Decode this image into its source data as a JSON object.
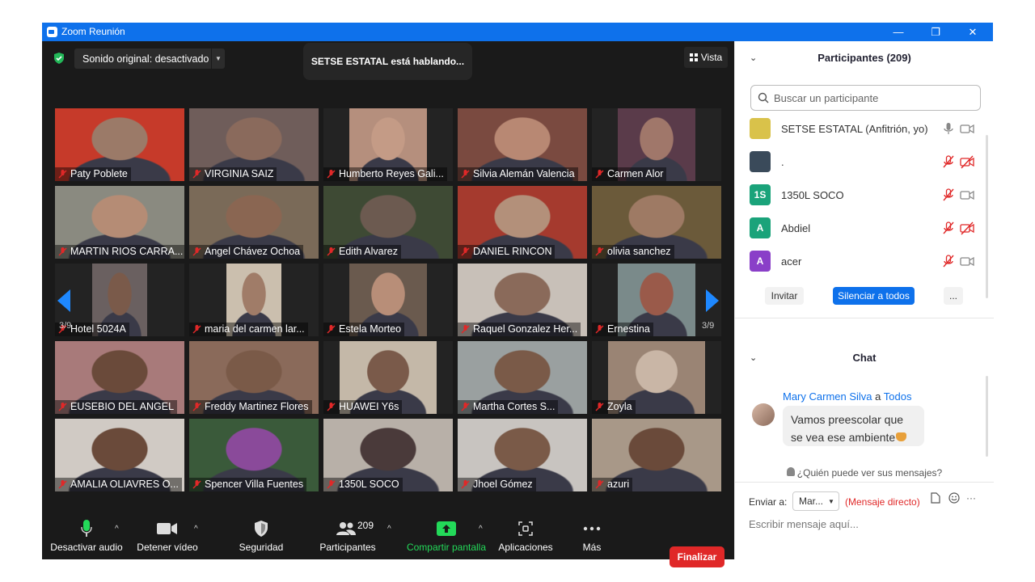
{
  "window": {
    "title": "Zoom Reunión",
    "minimize": "—",
    "restore": "❐",
    "close": "✕"
  },
  "top": {
    "sound_label": "Sonido original: desactivado",
    "sound_caret": "▼",
    "speaking": "SETSE ESTATAL está hablando...",
    "view_label": "Vista"
  },
  "gallery": {
    "page_left": "3/9",
    "page_right": "3/9",
    "tiles": [
      {
        "name": "Paty Poblete",
        "bg": "#c63a2a",
        "face": "#9b7a68"
      },
      {
        "name": "VIRGINIA SAIZ",
        "bg": "#6f5d5a",
        "face": "#8a6a5c"
      },
      {
        "name": "Humberto Reyes Gali...",
        "bg": "#b58f7d",
        "face": "#c49b86"
      },
      {
        "name": "Silvia Alemán Valencia",
        "bg": "#7a4a40",
        "face": "#b88873"
      },
      {
        "name": "Carmen Alor",
        "bg": "#5a3b4a",
        "face": "#a0776a"
      },
      {
        "name": "MARTIN RIOS CARRA...",
        "bg": "#8a8a80",
        "face": "#b58c75"
      },
      {
        "name": "Angel Chávez Ochoa",
        "bg": "#7a6a58",
        "face": "#8a6652"
      },
      {
        "name": "Edith Alvarez",
        "bg": "#3e4a34",
        "face": "#6c5a50"
      },
      {
        "name": "DANIEL RINCON",
        "bg": "#a53a2e",
        "face": "#b3907a"
      },
      {
        "name": "olivia sanchez",
        "bg": "#6b5a3a",
        "face": "#9e7a64"
      },
      {
        "name": "Hotel 5024A",
        "bg": "#6a6060",
        "face": "#7a5a4a"
      },
      {
        "name": "maria del carmen lar...",
        "bg": "#cbbfae",
        "face": "#a07c68"
      },
      {
        "name": "Estela Morteo",
        "bg": "#6a5a4e",
        "face": "#b88e78"
      },
      {
        "name": "Raquel Gonzalez Her...",
        "bg": "#c8c0b8",
        "face": "#8a6a5a"
      },
      {
        "name": "Ernestina",
        "bg": "#7a8a8a",
        "face": "#9a5a4a"
      },
      {
        "name": "EUSEBIO DEL ANGEL",
        "bg": "#a87a7a",
        "face": "#6a4a3a"
      },
      {
        "name": "Freddy Martinez Flores",
        "bg": "#8a6a5a",
        "face": "#7a5a48"
      },
      {
        "name": "HUAWEI Y6s",
        "bg": "#c4b8a8",
        "face": "#7a5a4a"
      },
      {
        "name": "Martha Cortes S...",
        "bg": "#9aa0a0",
        "face": "#7a5a48"
      },
      {
        "name": "Zoyla",
        "bg": "#9a8474",
        "face": "#c9b6a6"
      },
      {
        "name": "AMALIA OLIAVRES O...",
        "bg": "#d0cac4",
        "face": "#6a4a3a"
      },
      {
        "name": "Spencer Villa Fuentes",
        "bg": "#3a5a3a",
        "face": "#8a4a9a"
      },
      {
        "name": "1350L SOCO",
        "bg": "#b8b0a8",
        "face": "#4a3a3a"
      },
      {
        "name": "Jhoel Gómez",
        "bg": "#c8c4c0",
        "face": "#7a5a48"
      },
      {
        "name": "azuri",
        "bg": "#a89888",
        "face": "#6a4a3a"
      }
    ]
  },
  "toolbar": {
    "audio": "Desactivar audio",
    "video": "Detener vídeo",
    "security": "Seguridad",
    "participants": "Participantes",
    "participants_count": "209",
    "share": "Compartir pantalla",
    "apps": "Aplicaciones",
    "more": "Más",
    "end": "Finalizar",
    "caret": "^"
  },
  "participants_panel": {
    "title": "Participantes (209)",
    "collapse": "⌄",
    "search_placeholder": "Buscar un participante",
    "list": [
      {
        "initials": "",
        "name": "SETSE ESTATAL (Anfitrión, yo)",
        "color": "#d9c24a"
      },
      {
        "initials": "",
        "name": ".",
        "color": "#3a4a5a"
      },
      {
        "initials": "1S",
        "name": "1350L SOCO",
        "color": "#1aa37a"
      },
      {
        "initials": "A",
        "name": "Abdiel",
        "color": "#1aa37a"
      },
      {
        "initials": "A",
        "name": "acer",
        "color": "#8a3fc8"
      }
    ],
    "invite": "Invitar",
    "mute_all": "Silenciar a todos",
    "more": "..."
  },
  "chat": {
    "title": "Chat",
    "collapse": "⌄",
    "sender": "Mary Carmen Silva",
    "to_word": "a",
    "recipient": "Todos",
    "message": "Vamos preescolar que se vea ese ambiente",
    "who_can_see": "¿Quién puede ver sus mensajes?",
    "send_to_label": "Enviar a:",
    "send_to_value": "Mar...",
    "direct": "(Mensaje directo)",
    "input_placeholder": "Escribir mensaje aquí...",
    "more": "···"
  },
  "colors": {
    "accent": "#0e71eb",
    "end": "#e02828",
    "share": "#23d959",
    "muted_red": "#e02828"
  }
}
